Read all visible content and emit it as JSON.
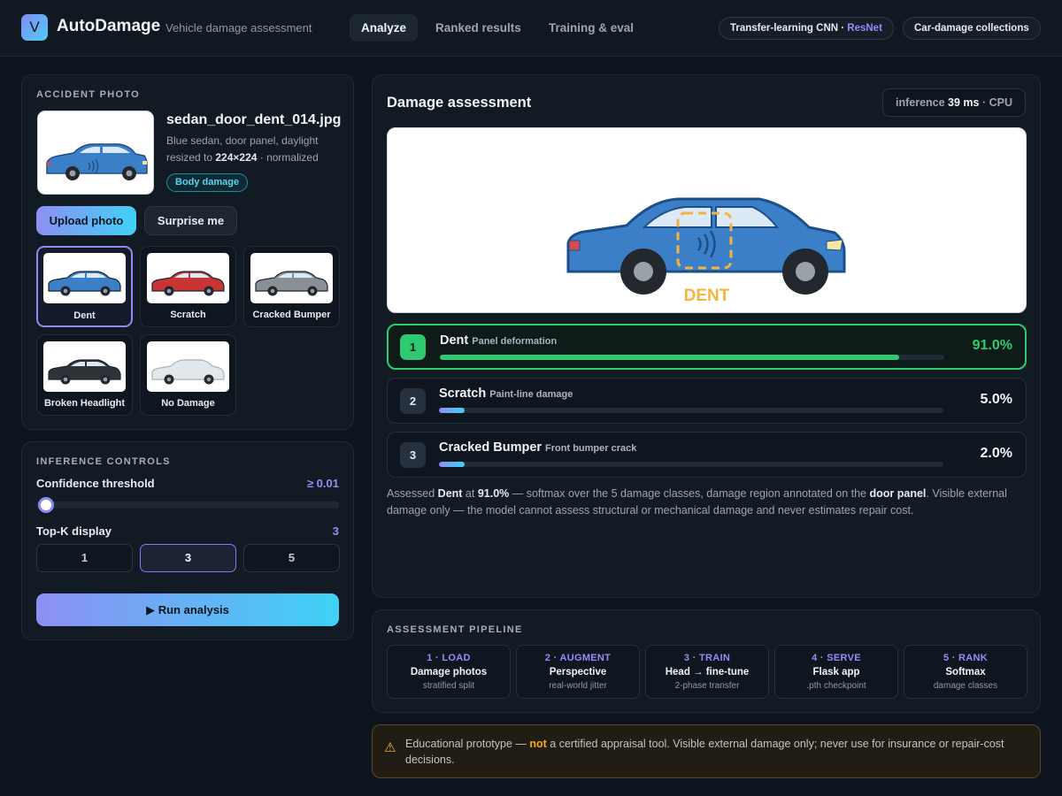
{
  "header": {
    "logo_letter": "V",
    "brand": "AutoDamage",
    "tagline": "Vehicle damage assessment",
    "nav": [
      {
        "label": "Analyze",
        "active": true
      },
      {
        "label": "Ranked results",
        "active": false
      },
      {
        "label": "Training & eval",
        "active": false
      }
    ],
    "model_pill_prefix": "Transfer-learning CNN · ",
    "model_pill_accent": "ResNet",
    "collections_pill": "Car-damage collections"
  },
  "photo": {
    "section_title": "ACCIDENT PHOTO",
    "filename": "sedan_door_dent_014.jpg",
    "description": "Blue sedan, door panel, daylight",
    "resize_prefix": "resized to ",
    "resize_size": "224×224",
    "resize_suffix": " · normalized",
    "badge": "Body damage",
    "upload_label": "Upload photo",
    "surprise_label": "Surprise me",
    "samples": [
      {
        "label": "Dent",
        "color": "#3a7fc8",
        "selected": true
      },
      {
        "label": "Scratch",
        "color": "#c93434",
        "selected": false
      },
      {
        "label": "Cracked Bumper",
        "color": "#8a8f96",
        "selected": false
      },
      {
        "label": "Broken Headlight",
        "color": "#2f3338",
        "selected": false
      },
      {
        "label": "No Damage",
        "color": "#e4e7ea",
        "selected": false
      }
    ]
  },
  "controls": {
    "section_title": "INFERENCE CONTROLS",
    "threshold_label": "Confidence threshold",
    "threshold_value": "≥ 0.01",
    "threshold": 0.01,
    "topk_label": "Top-K display",
    "topk_value": "3",
    "topk_options": [
      "1",
      "3",
      "5"
    ],
    "topk_selected": "3",
    "run_label": "▶ Run analysis"
  },
  "assessment": {
    "title": "Damage assessment",
    "inference_prefix": "inference ",
    "inference_ms": "39 ms",
    "inference_suffix": " · CPU",
    "viz_label": "DENT",
    "results": [
      {
        "rank": "1",
        "name": "Dent",
        "sub": "Panel deformation",
        "pct": "91.0%",
        "value": 0.91
      },
      {
        "rank": "2",
        "name": "Scratch",
        "sub": "Paint-line damage",
        "pct": "5.0%",
        "value": 0.05
      },
      {
        "rank": "3",
        "name": "Cracked Bumper",
        "sub": "Front bumper crack",
        "pct": "2.0%",
        "value": 0.02
      }
    ],
    "summary_parts": [
      {
        "t": "Assessed ",
        "b": false
      },
      {
        "t": "Dent",
        "b": true
      },
      {
        "t": " at ",
        "b": false
      },
      {
        "t": "91.0%",
        "b": true
      },
      {
        "t": " — softmax over the 5 damage classes, damage region annotated on the ",
        "b": false
      },
      {
        "t": "door panel",
        "b": true
      },
      {
        "t": ". Visible external damage only — the model cannot assess structural or mechanical damage and never estimates repair cost.",
        "b": false
      }
    ]
  },
  "pipeline": {
    "section_title": "ASSESSMENT PIPELINE",
    "steps": [
      {
        "step": "1 · LOAD",
        "title": "Damage photos",
        "sub": "stratified split"
      },
      {
        "step": "2 · AUGMENT",
        "title": "Perspective",
        "sub": "real-world jitter"
      },
      {
        "step": "3 · TRAIN",
        "title": "Head → fine-tune",
        "sub": "2-phase transfer"
      },
      {
        "step": "4 · SERVE",
        "title": "Flask app",
        "sub": ".pth checkpoint"
      },
      {
        "step": "5 · RANK",
        "title": "Softmax",
        "sub": "damage classes"
      }
    ]
  },
  "warning": {
    "icon": "warning-icon",
    "prefix": "Educational prototype — ",
    "emph": "not",
    "suffix": " a certified appraisal tool. Visible external damage only; never use for insurance or repair-cost decisions."
  }
}
